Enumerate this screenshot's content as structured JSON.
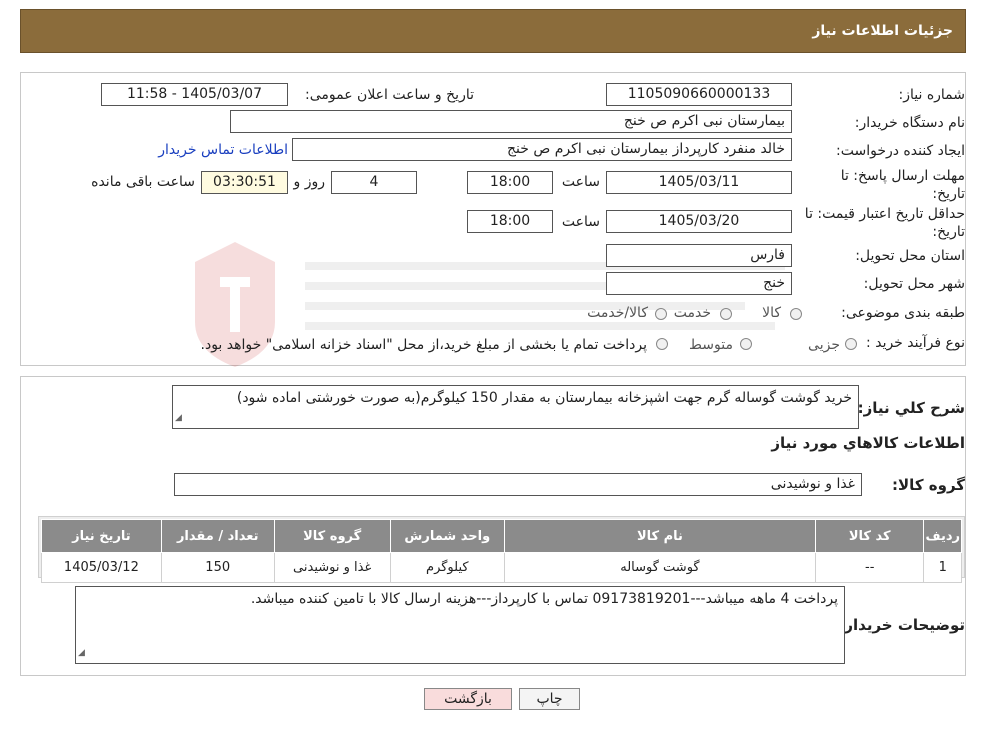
{
  "header": {
    "title": "جزئیات اطلاعات نیاز"
  },
  "form": {
    "need_number_label": "شماره نیاز:",
    "need_number": "1105090660000133",
    "announce_label": "تاریخ و ساعت اعلان عمومی:",
    "announce_value": "1405/03/07 - 11:58",
    "buyer_org_label": "نام دستگاه خریدار:",
    "buyer_org": "بیمارستان نبی اکرم  ص  خنج",
    "creator_label": "ایجاد کننده درخواست:",
    "creator": "خالد منفرد کارپرداز بیمارستان نبی اکرم  ص  خنج",
    "contact_link": "اطلاعات تماس خریدار",
    "deadline_label_1": "مهلت ارسال پاسخ: تا",
    "deadline_label_2": "تاریخ:",
    "deadline_date": "1405/03/11",
    "time_label": "ساعت",
    "deadline_time": "18:00",
    "days_value": "4",
    "days_label": "روز و",
    "remaining_time": "03:30:51",
    "remaining_label": "ساعت باقی مانده",
    "validity_label_1": "حداقل تاریخ اعتبار قیمت: تا",
    "validity_label_2": "تاریخ:",
    "validity_date": "1405/03/20",
    "validity_time": "18:00",
    "province_label": "استان محل تحویل:",
    "province": "فارس",
    "city_label": "شهر محل تحویل:",
    "city": "خنج",
    "category_label": "طبقه بندی موضوعی:",
    "category_options": [
      "کالا",
      "خدمت",
      "کالا/خدمت"
    ],
    "process_label": "نوع فرآیند خرید :",
    "process_options": [
      "جزیی",
      "متوسط"
    ],
    "process_note": "پرداخت تمام یا بخشی از مبلغ خرید،از محل \"اسناد خزانه اسلامی\" خواهد بود."
  },
  "description": {
    "label": "شرح کلي نياز:",
    "text": "خرید گوشت گوساله گرم جهت اشپزخانه بیمارستان به مقدار 150 کیلوگرم(به صورت خورشتی اماده شود)"
  },
  "goods_section_title": "اطلاعات کالاهاي مورد نياز",
  "goods_group": {
    "label": "گروه کالا:",
    "value": "غذا و نوشیدنی"
  },
  "table": {
    "headers": [
      "رديف",
      "کد کالا",
      "نام کالا",
      "واحد شمارش",
      "گروه کالا",
      "تعداد / مقدار",
      "تاریخ نیاز"
    ],
    "rows": [
      [
        "1",
        "--",
        "گوشت گوساله",
        "کیلوگرم",
        "غذا و نوشیدنی",
        "150",
        "1405/03/12"
      ]
    ]
  },
  "buyer_notes": {
    "label": "توضیحات خریدار:",
    "text": "پرداخت 4 ماهه میباشد---09173819201 تماس با کارپرداز---هزینه ارسال کالا با تامین کننده میباشد."
  },
  "buttons": {
    "print": "چاپ",
    "back": "بازگشت"
  },
  "colors": {
    "header_bg": "#8b6c3b",
    "table_header_bg": "#8b8b8b",
    "back_button_bg": "#f9dcdc"
  }
}
